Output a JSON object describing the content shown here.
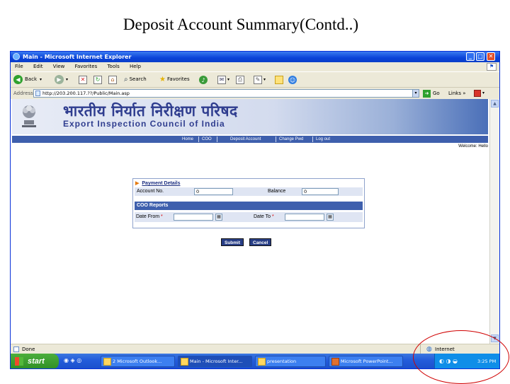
{
  "slide": {
    "title": "Deposit Account Summary(Contd..)"
  },
  "window": {
    "title": "Main - Microsoft Internet Explorer",
    "controls": {
      "minimize": "_",
      "maximize": "□",
      "close": "✕"
    }
  },
  "menu": [
    "File",
    "Edit",
    "View",
    "Favorites",
    "Tools",
    "Help"
  ],
  "toolbar": {
    "back": "Back",
    "search": "Search",
    "favorites": "Favorites"
  },
  "address": {
    "label": "Address",
    "url": "http://203.200.117.??/Public/Main.asp",
    "go": "Go",
    "links": "Links"
  },
  "site": {
    "hindi_title": "भारतीय निर्यात निरीक्षण परिषद",
    "english_title": "Export Inspection Council of India",
    "nav": [
      "Home",
      "COO",
      "Deposit Account",
      "Change Pwd",
      "Log out"
    ],
    "welcome": "Welcome: Hello"
  },
  "form": {
    "section_title": "Payment Details",
    "account_label": "Account No.",
    "account_value": "0",
    "balance_label": "Balance",
    "balance_value": "0",
    "coo_title": "COO Reports",
    "date_from_label": "Date From",
    "date_to_label": "Date To",
    "required_mark": "*",
    "submit": "Submit",
    "cancel": "Cancel"
  },
  "status": {
    "left": "Done",
    "zone": "Internet"
  },
  "taskbar": {
    "start": "start",
    "tasks": [
      "2 Microsoft Outlook...",
      "Main - Microsoft Inter...",
      "presentation",
      "Microsoft PowerPoint..."
    ],
    "clock": "3:25 PM"
  },
  "colors": {
    "nav_bar": "#3e5fad",
    "annotation_oval": "#d00000",
    "title_bar": "#0a43d8"
  }
}
